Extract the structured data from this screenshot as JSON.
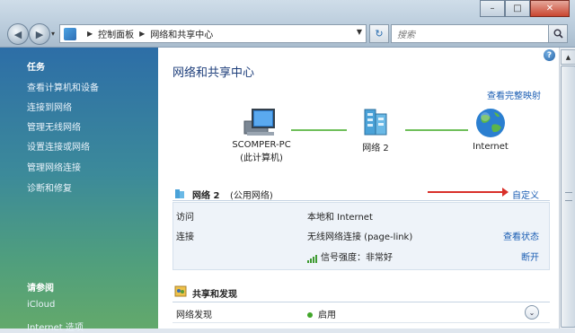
{
  "address": {
    "breadcrumbs": [
      "控制面板",
      "网络和共享中心"
    ],
    "search_placeholder": "搜索"
  },
  "window_buttons": {
    "minimize": "–",
    "maximize": "□",
    "close": "✕"
  },
  "sidebar": {
    "tasks_title": "任务",
    "tasks": [
      "查看计算机和设备",
      "连接到网络",
      "管理无线网络",
      "设置连接或网络",
      "管理网络连接",
      "诊断和修复"
    ],
    "see_also_title": "请参阅",
    "see_also": [
      "iCloud",
      "Internet 选项"
    ]
  },
  "main": {
    "title": "网络和共享中心",
    "full_map_link": "查看完整映射",
    "help": "?",
    "nodes": [
      {
        "name": "SCOMPER-PC",
        "sub": "(此计算机)"
      },
      {
        "name": "网络  2",
        "sub": ""
      },
      {
        "name": "Internet",
        "sub": ""
      }
    ],
    "network": {
      "name": "网络  2",
      "type": "(公用网络)",
      "customize_link": "自定义",
      "rows": [
        {
          "label": "访问",
          "value": "本地和 Internet",
          "link": ""
        },
        {
          "label": "连接",
          "value": "无线网络连接 (page-link)",
          "link": "查看状态"
        }
      ],
      "signal_label": "信号强度：非常好",
      "disconnect_link": "断开"
    },
    "sharing": {
      "title": "共享和发现",
      "rows": [
        {
          "label": "网络发现",
          "value": "启用"
        }
      ]
    }
  },
  "colors": {
    "link": "#1a5db3",
    "title": "#1c3d7a",
    "arrow": "#d9302a",
    "signal": "#3f9a32"
  }
}
